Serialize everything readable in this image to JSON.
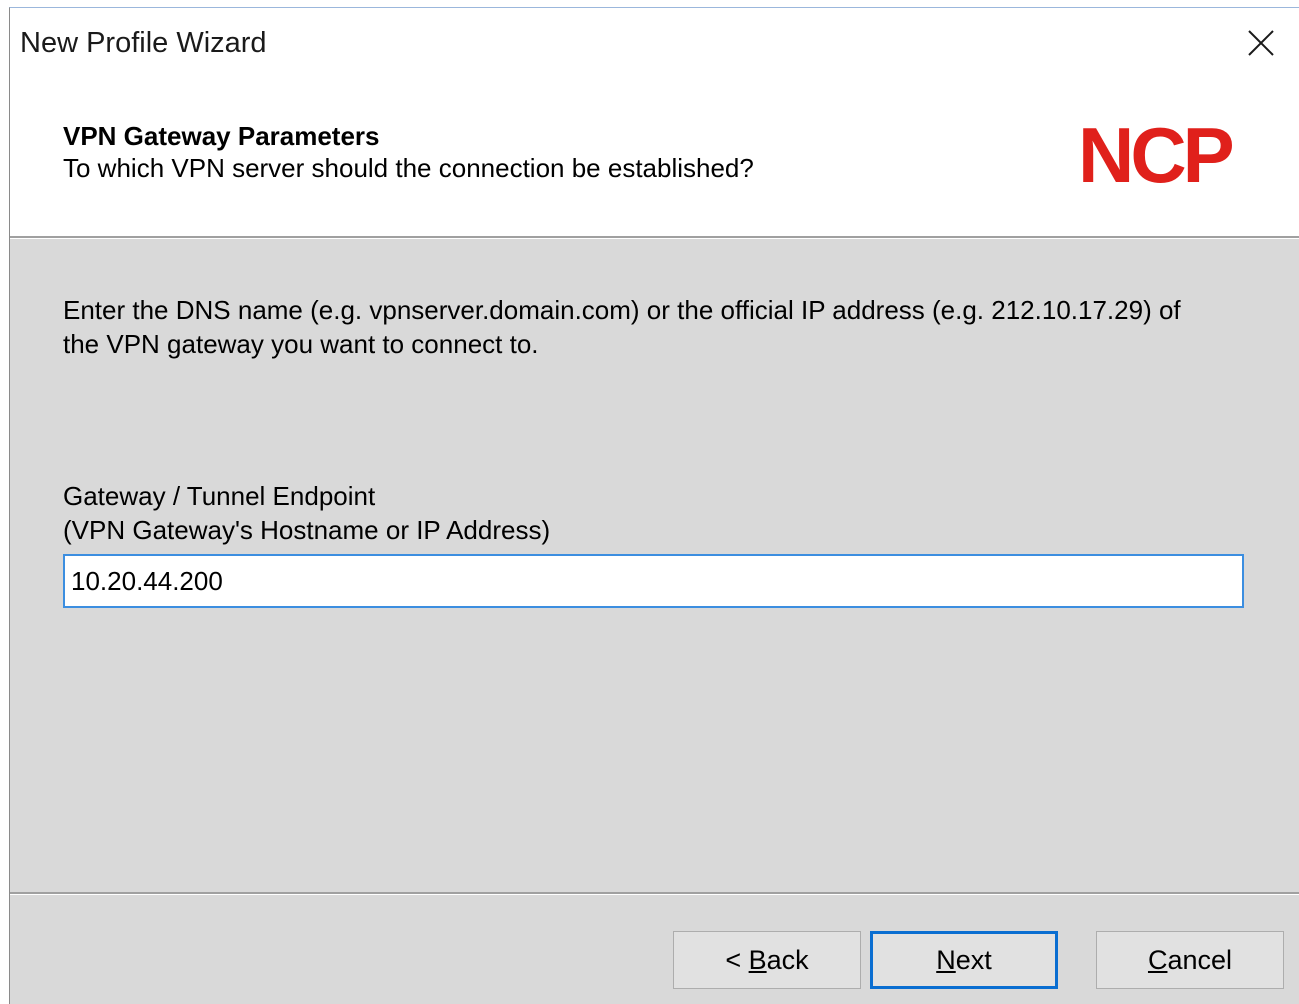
{
  "window": {
    "title": "New Profile Wizard"
  },
  "header": {
    "title": "VPN Gateway Parameters",
    "subtitle": "To which VPN server should the connection be established?",
    "logo_text": "NCP",
    "logo_color": "#e0201b"
  },
  "content": {
    "description": "Enter the DNS name (e.g. vpnserver.domain.com) or the official IP address (e.g. 212.10.17.29) of the VPN gateway you want to connect to.",
    "field_label": "Gateway / Tunnel Endpoint",
    "field_hint": "(VPN Gateway's Hostname or IP Address)",
    "gateway_value": "10.20.44.200"
  },
  "buttons": {
    "back": {
      "prefix": "< ",
      "accel": "B",
      "rest": "ack"
    },
    "next": {
      "accel": "N",
      "rest": "ext"
    },
    "cancel": {
      "accel": "C",
      "rest": "ancel"
    }
  },
  "icons": {
    "close": "close-icon"
  }
}
